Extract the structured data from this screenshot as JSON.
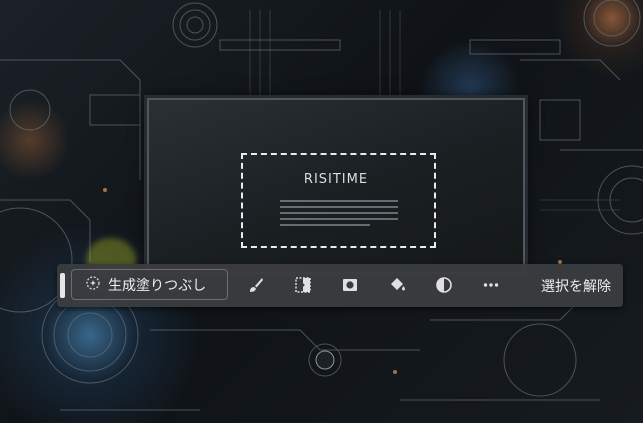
{
  "image": {
    "screen_title": "RISITIME",
    "accent_colors": {
      "highlight": "#c8d020",
      "toolbar_bg": "#3a3c3f",
      "text": "#f0f0f0"
    }
  },
  "toolbar": {
    "generative_fill_label": "生成塗りつぶし",
    "generative_fill_icon": "sparkle-icon",
    "tools": [
      {
        "name": "brush-icon"
      },
      {
        "name": "invert-selection-icon"
      },
      {
        "name": "mask-icon"
      },
      {
        "name": "paint-bucket-icon"
      },
      {
        "name": "adjustment-icon"
      },
      {
        "name": "more-icon"
      }
    ],
    "deselect_label": "選択を解除"
  }
}
